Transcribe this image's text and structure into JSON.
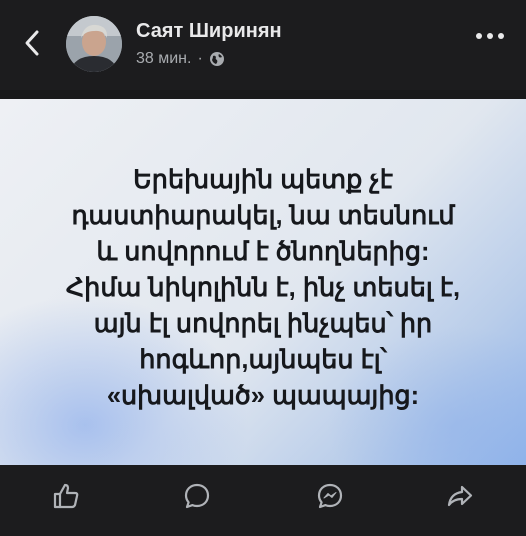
{
  "header": {
    "author_name": "Саят Ширинян",
    "timestamp": "38 мин.",
    "separator": "·",
    "privacy_icon": "globe-icon",
    "back_icon": "chevron-left-icon",
    "more_icon": "more-horizontal-icon"
  },
  "post": {
    "text_lines": [
      "Երեխային պետք չէ",
      "դաստիարակել, նա տեսնում",
      "և սովորում է ծնողներից:",
      "Հիմա նիկոլինն է, ինչ տեսել է,",
      "այն էլ սովորել ինչպես՝ իր",
      "հոգևոր,այնպես էլ՝",
      "«սխալված» պապայից:"
    ]
  },
  "actions": {
    "items": [
      {
        "name": "like",
        "icon": "thumbs-up-icon"
      },
      {
        "name": "comment",
        "icon": "comment-icon"
      },
      {
        "name": "messenger",
        "icon": "messenger-icon"
      },
      {
        "name": "share",
        "icon": "share-icon"
      }
    ]
  },
  "colors": {
    "background": "#18191a",
    "bar": "#1c1c1e",
    "text_primary": "#e9e9ea",
    "text_secondary": "#a8abaf",
    "post_text": "#16181c"
  }
}
